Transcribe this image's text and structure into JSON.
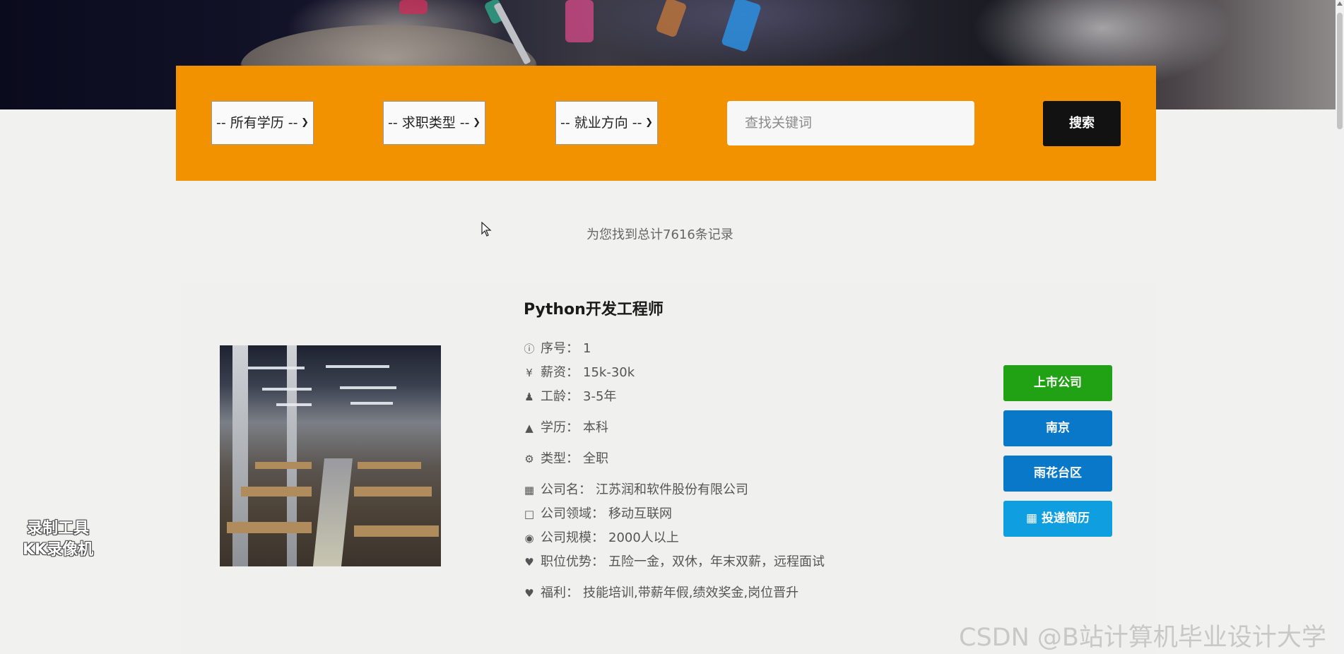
{
  "filters": {
    "education": "-- 所有学历 --",
    "job_type": "-- 求职类型 --",
    "direction": "-- 就业方向 --",
    "keyword_placeholder": "查找关键词",
    "search_label": "搜索"
  },
  "result_count": "为您找到总计7616条记录",
  "job": {
    "title": "Python开发工程师",
    "fields": [
      {
        "icon": "info-icon",
        "label": "序号：",
        "value": "1"
      },
      {
        "icon": "yen-icon",
        "label": "薪资：",
        "value": "15k-30k"
      },
      {
        "icon": "user-icon",
        "label": "工龄：",
        "value": "3-5年"
      },
      {
        "icon": "graduation-cap-icon",
        "label": "学历：",
        "value": "本科"
      },
      {
        "icon": "gear-icon",
        "label": "类型：",
        "value": "全职"
      },
      {
        "icon": "building-icon",
        "label": "公司名：",
        "value": "江苏润和软件股份有限公司"
      },
      {
        "icon": "building-outline-icon",
        "label": "公司领域：",
        "value": "移动互联网"
      },
      {
        "icon": "compass-icon",
        "label": "公司规模：",
        "value": "2000人以上"
      },
      {
        "icon": "heart-icon",
        "label": "职位优势：",
        "value": "五险一金，双休，年末双薪，远程面试"
      },
      {
        "icon": "heart-icon",
        "label": "福利：",
        "value": "技能培训,带薪年假,绩效奖金,岗位晋升"
      }
    ],
    "tags": {
      "listed": "上市公司",
      "city": "南京",
      "district": "雨花台区",
      "apply": "投递简历"
    }
  },
  "watermarks": {
    "recorder_line1": "录制工具",
    "recorder_line2": "KK录像机",
    "csdn": "CSDN @B站计算机毕业设计大学"
  }
}
